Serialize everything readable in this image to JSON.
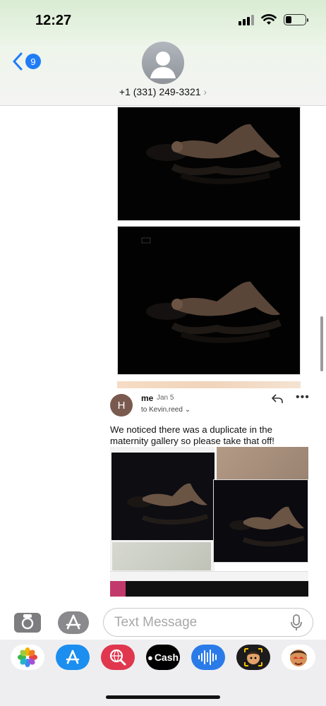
{
  "status_bar": {
    "time": "12:27"
  },
  "header": {
    "back_badge": "9",
    "contact_name": "+1 (331) 249-3321",
    "contact_arrow": "›"
  },
  "thread": {
    "email": {
      "avatar_initial": "H",
      "sender": "me",
      "date": "Jan 5",
      "recipient": "to Kevin.reed",
      "recipient_chevron": "⌄",
      "more": "•••",
      "body": "We noticed there was a duplicate in the maternity gallery so please take that off!"
    }
  },
  "composer": {
    "placeholder": "Text Message"
  },
  "app_drawer": {
    "apps": [
      {
        "name": "photos-app-icon"
      },
      {
        "name": "app-store-icon"
      },
      {
        "name": "web-search-app-icon"
      },
      {
        "name": "apple-cash-icon",
        "label": "Cash"
      },
      {
        "name": "audio-message-icon"
      },
      {
        "name": "memoji-icon"
      },
      {
        "name": "animoji-icon"
      }
    ]
  },
  "colors": {
    "accent": "#1f7cf7",
    "avatar_email": "#7a5a4f"
  }
}
